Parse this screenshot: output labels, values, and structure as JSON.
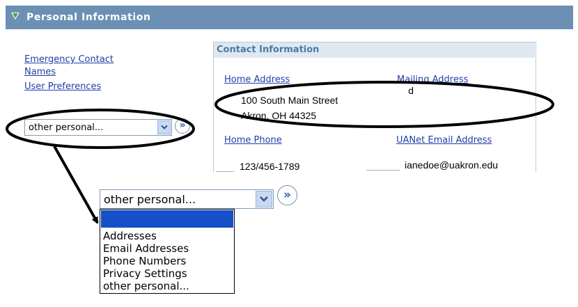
{
  "header": {
    "title": "Personal Information"
  },
  "left_links": [
    "Emergency Contact",
    "Names",
    "User Preferences"
  ],
  "nav_select": {
    "value": "other personal...",
    "go_label": "»"
  },
  "contact": {
    "heading": "Contact Information",
    "home_address_label": "Home Address",
    "mailing_address_label": "Mailing Address",
    "home_address_line1": "100 South Main Street",
    "home_address_line2": "Akron, OH 44325",
    "mailing_address_value": "d",
    "home_phone_label": "Home Phone",
    "email_label": "UANet Email Address",
    "home_phone_value": "123/456-1789",
    "email_value": "ianedoe@uakron.edu"
  },
  "zoom_select": {
    "value": "other personal...",
    "go_label": "»",
    "options": [
      "",
      "Addresses",
      "Email Addresses",
      "Phone Numbers",
      "Privacy Settings",
      "other personal..."
    ]
  },
  "icons": [
    "expand-triangle-icon",
    "chevron-down-icon",
    "go-arrow-icon"
  ],
  "colors": {
    "header_bg": "#6b90b4",
    "link": "#1f3fa8",
    "highlight": "#1650c8",
    "box_header": "#dfe8f1"
  }
}
